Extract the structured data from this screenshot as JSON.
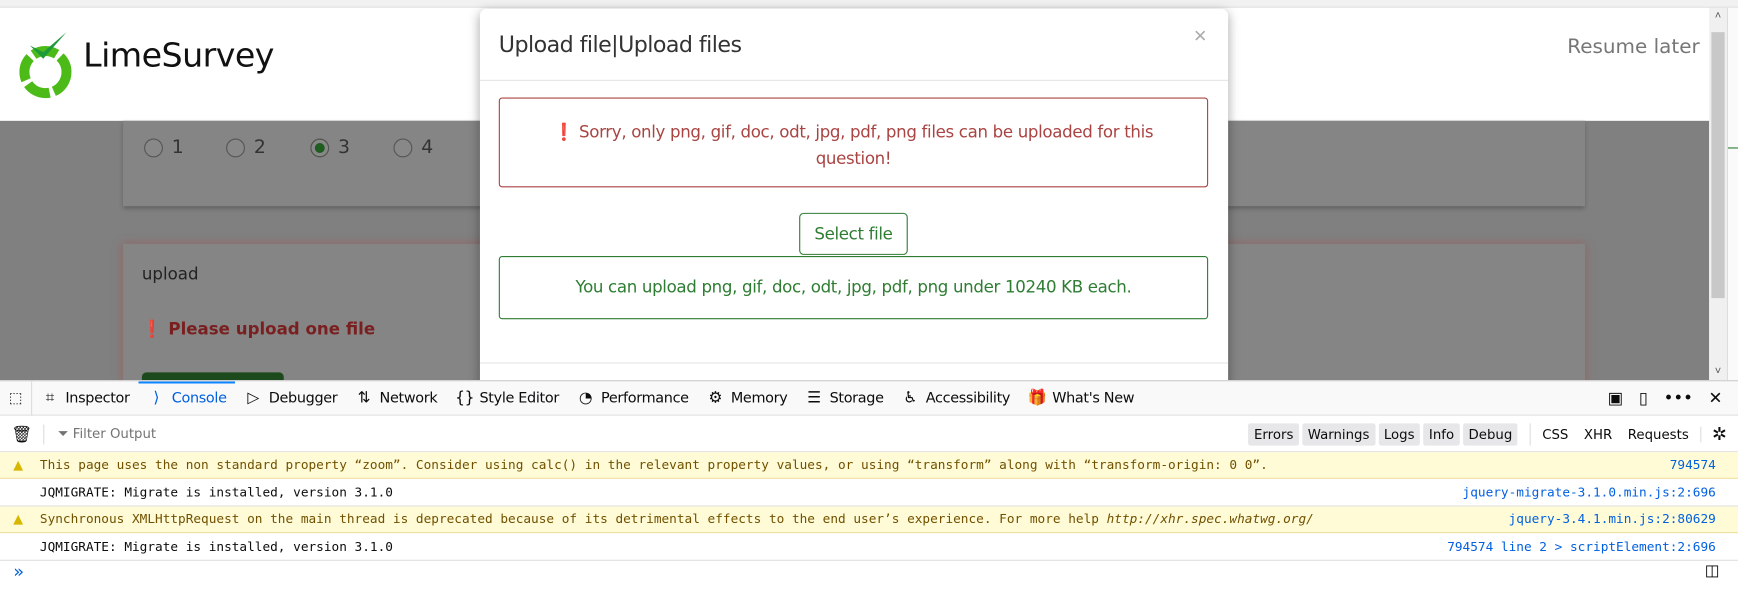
{
  "page": {
    "brand": "LimeSurvey",
    "resume_later": "Resume later",
    "radio_options": [
      "1",
      "2",
      "3",
      "4"
    ],
    "selected_option": "3",
    "question_title": "upload",
    "question_error": "Please upload one file"
  },
  "modal": {
    "title": "Upload file|Upload files",
    "close": "×",
    "error": "Sorry, only png, gif, doc, odt, jpg, pdf, png files can be uploaded for this question!",
    "select_file": "Select file",
    "info": "You can upload png, gif, doc, odt, jpg, pdf, png under 10240 KB each."
  },
  "devtools": {
    "tabs": [
      {
        "label": "Inspector",
        "icon": "inspector-icon"
      },
      {
        "label": "Console",
        "icon": "console-icon"
      },
      {
        "label": "Debugger",
        "icon": "debugger-icon"
      },
      {
        "label": "Network",
        "icon": "network-icon"
      },
      {
        "label": "Style Editor",
        "icon": "style-editor-icon"
      },
      {
        "label": "Performance",
        "icon": "performance-icon"
      },
      {
        "label": "Memory",
        "icon": "memory-icon"
      },
      {
        "label": "Storage",
        "icon": "storage-icon"
      },
      {
        "label": "Accessibility",
        "icon": "accessibility-icon"
      },
      {
        "label": "What's New",
        "icon": "gift-icon"
      }
    ],
    "active_tab": "Console",
    "filter_placeholder": "Filter Output",
    "levels": [
      "Errors",
      "Warnings",
      "Logs",
      "Info",
      "Debug"
    ],
    "extra_filters": [
      "CSS",
      "XHR",
      "Requests"
    ],
    "messages": [
      {
        "type": "warning",
        "text": "This page uses the non standard property “zoom”. Consider using calc() in the relevant property values, or using “transform” along with “transform-origin: 0 0”.",
        "source": "794574"
      },
      {
        "type": "log",
        "text": "JQMIGRATE: Migrate is installed, version 3.1.0",
        "source": "jquery-migrate-3.1.0.min.js:2:696"
      },
      {
        "type": "warning",
        "text": "Synchronous XMLHttpRequest on the main thread is deprecated because of its detrimental effects to the end user’s experience. For more help ",
        "link": "http://xhr.spec.whatwg.org/",
        "source": "jquery-3.4.1.min.js:2:80629"
      },
      {
        "type": "log",
        "text": "JQMIGRATE: Migrate is installed, version 3.1.0",
        "source": "794574 line 2 > scriptElement:2:696"
      }
    ],
    "prompt": "»"
  }
}
